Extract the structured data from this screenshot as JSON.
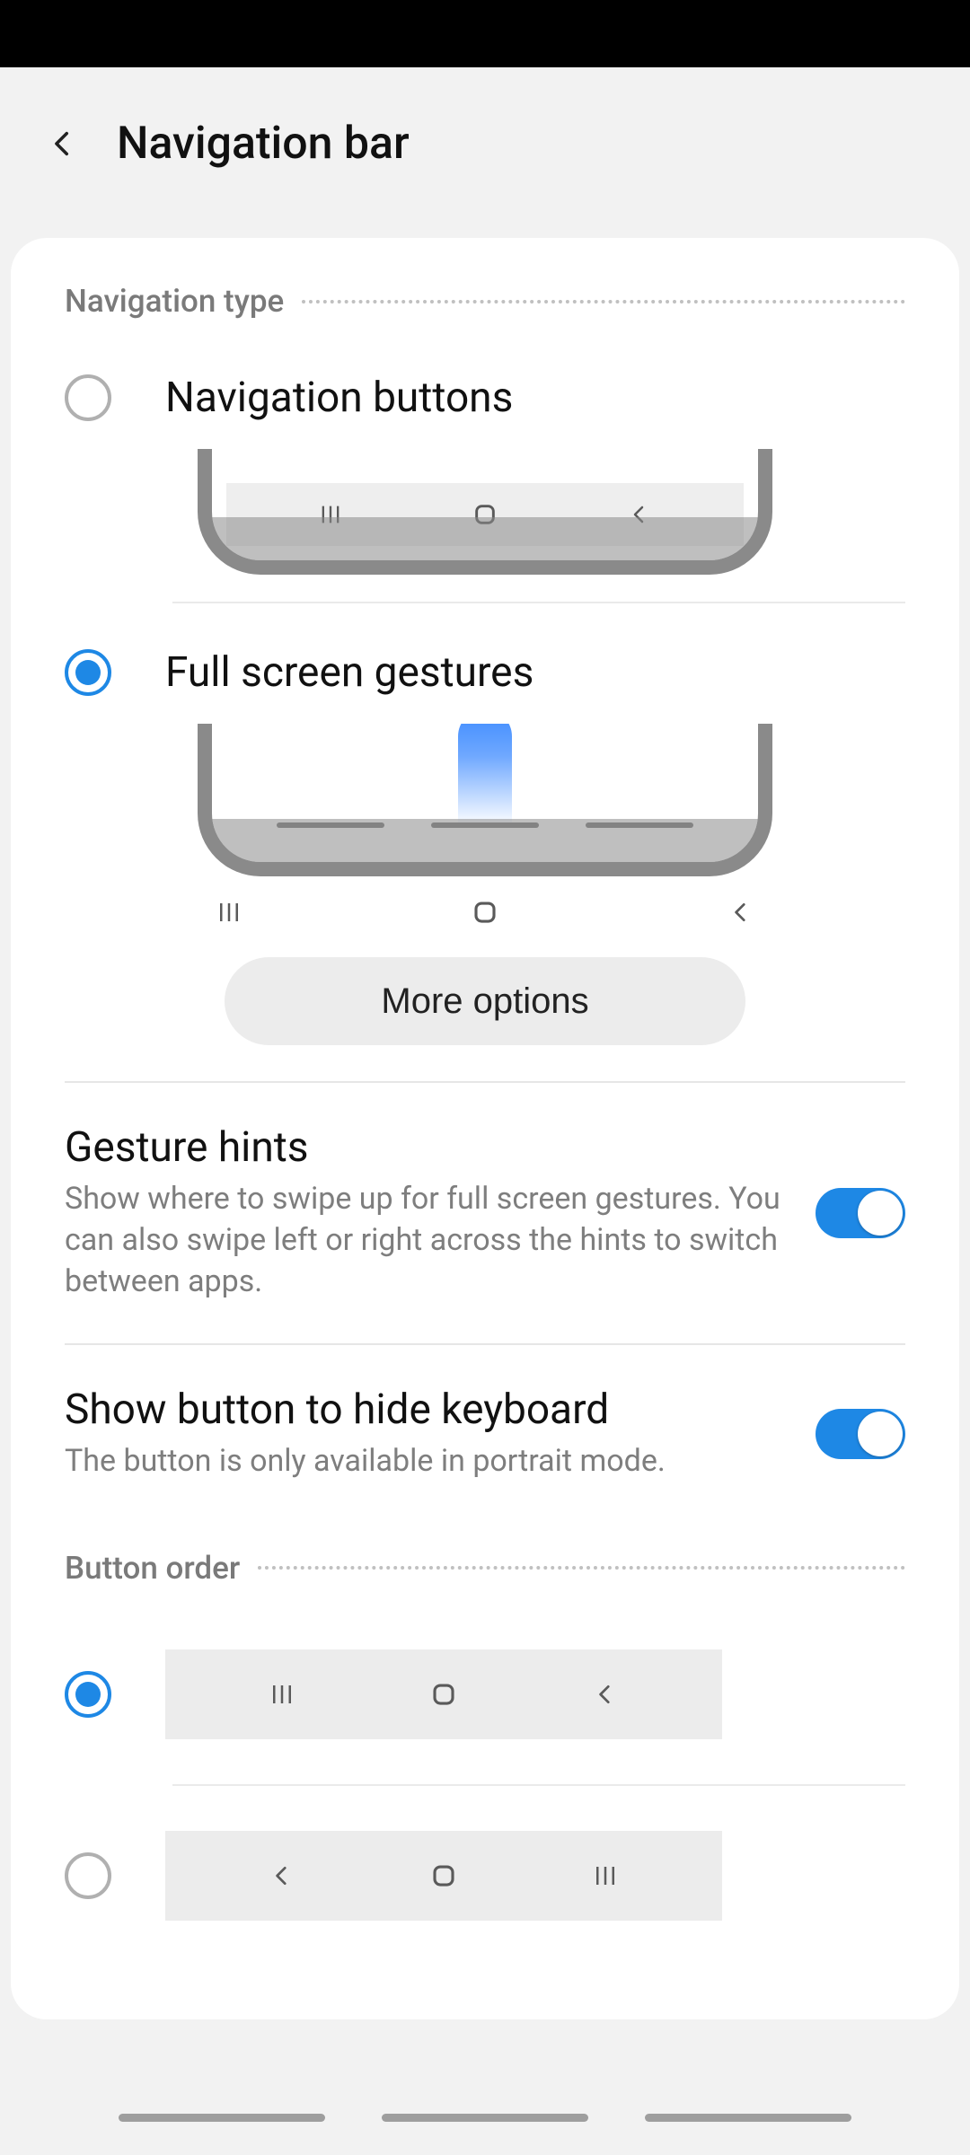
{
  "header": {
    "title": "Navigation bar"
  },
  "sections": {
    "nav_type": {
      "label": "Navigation type",
      "option_buttons": "Navigation buttons",
      "option_gestures": "Full screen gestures",
      "more_options": "More options"
    },
    "gesture_hints": {
      "title": "Gesture hints",
      "subtitle": "Show where to swipe up for full screen gestures. You can also swipe left or right across the hints to switch between apps.",
      "enabled": true
    },
    "show_button_hide_kb": {
      "title": "Show button to hide keyboard",
      "subtitle": "The button is only available in portrait mode.",
      "enabled": true
    },
    "button_order": {
      "label": "Button order"
    }
  },
  "icons": {
    "recent": "|||",
    "home": "○",
    "back": "‹"
  }
}
